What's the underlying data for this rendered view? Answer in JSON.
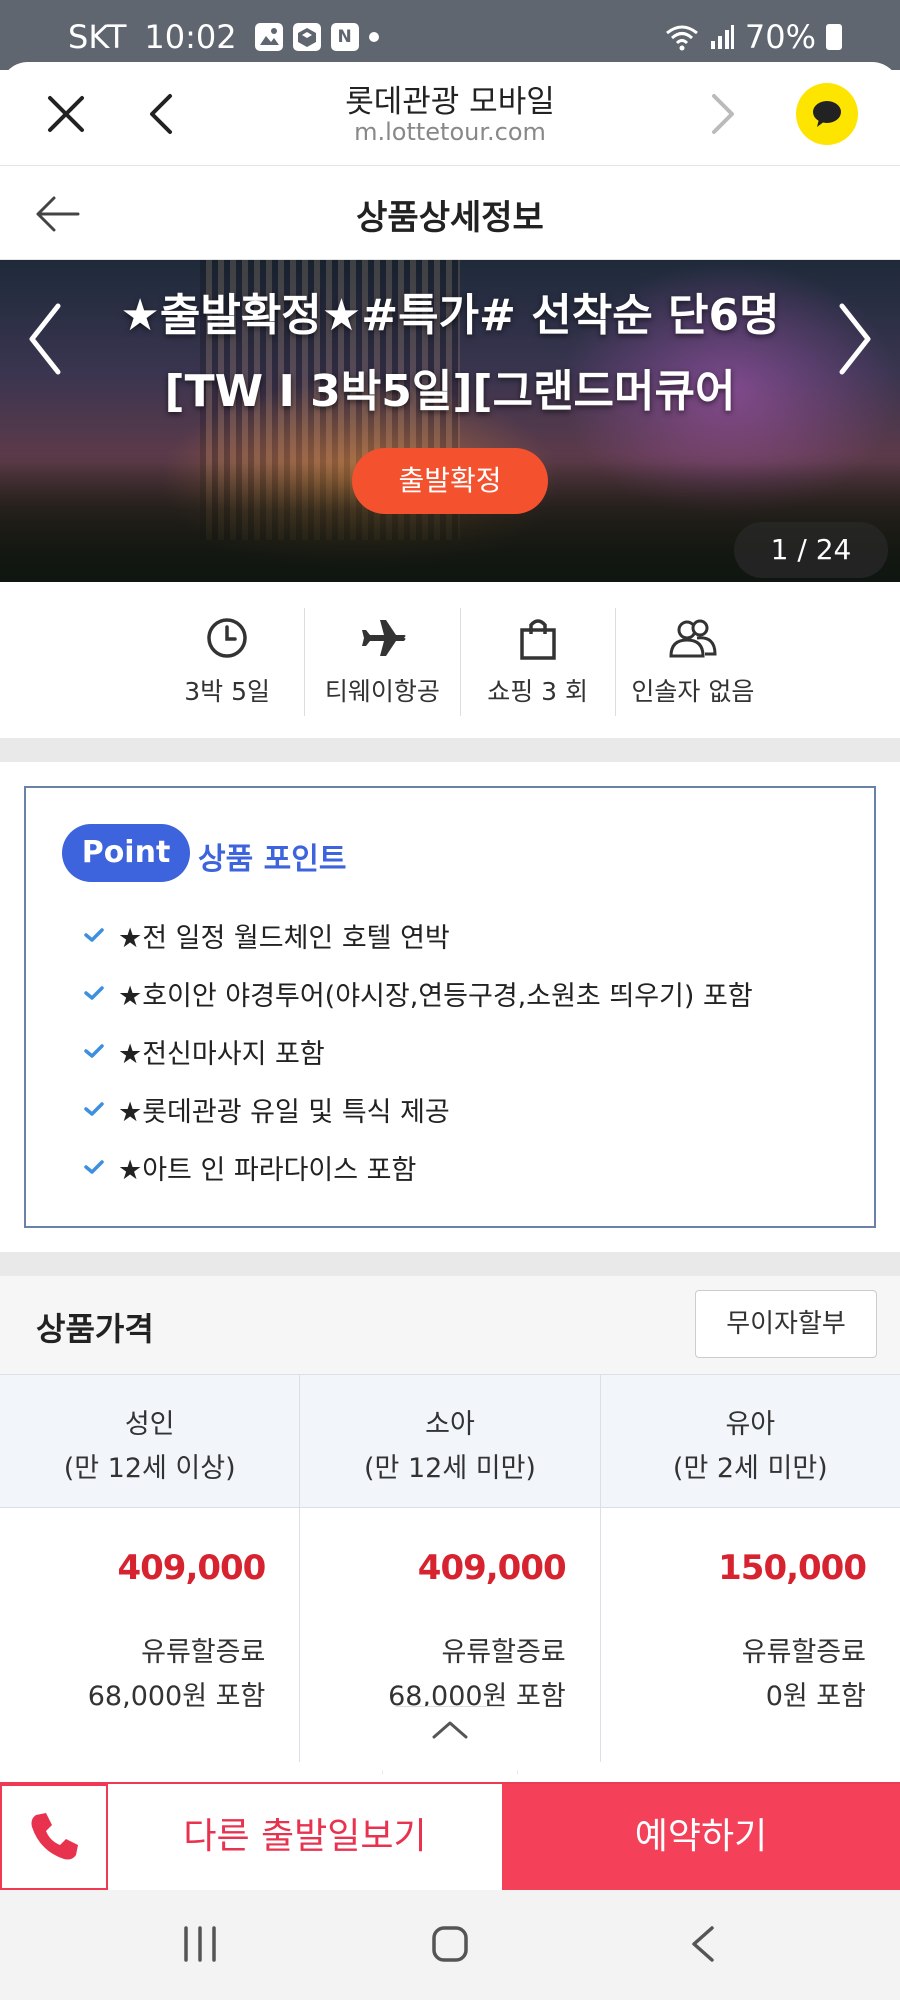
{
  "status_bar": {
    "carrier": "SKT",
    "time": "10:02",
    "battery": "70%",
    "notification_icons": [
      "image-icon",
      "box-icon",
      "naver-icon"
    ],
    "naver_letter": "N"
  },
  "browser": {
    "title": "롯데관광 모바일",
    "url": "m.lottetour.com"
  },
  "page": {
    "title": "상품상세정보"
  },
  "hero": {
    "title": "★출발확정★#특가# 선착순 단6명 [TW I 3박5일][그랜드머큐어",
    "badge": "출발확정",
    "counter": "1 / 24"
  },
  "info": [
    {
      "icon": "clock-icon",
      "label": "3박 5일"
    },
    {
      "icon": "airplane-icon",
      "label": "티웨이항공"
    },
    {
      "icon": "shopping-bag-icon",
      "label": "쇼핑 3 회"
    },
    {
      "icon": "people-icon",
      "label": "인솔자 없음"
    }
  ],
  "point": {
    "pill": "Point",
    "title": "상품 포인트",
    "items": [
      "★전 일정 월드체인 호텔 연박",
      "★호이안 야경투어(야시장,연등구경,소원초 띄우기) 포함",
      "★전신마사지 포함",
      "★롯데관광 유일 및 특식 제공",
      "★아트 인 파라다이스 포함"
    ]
  },
  "price": {
    "title": "상품가격",
    "installment_button": "무이자할부",
    "columns": [
      {
        "name": "성인",
        "age": "(만 12세 이상)",
        "price": "409,000",
        "note1": "유류할증료",
        "note2": "68,000원 포함"
      },
      {
        "name": "소아",
        "age": "(만 12세 미만)",
        "price": "409,000",
        "note1": "유류할증료",
        "note2": "68,000원 포함"
      },
      {
        "name": "유아",
        "age": "(만 2세 미만)",
        "price": "150,000",
        "note1": "유류할증료",
        "note2": "0원 포함"
      }
    ]
  },
  "actions": {
    "other_dates": "다른 출발일보기",
    "reserve": "예약하기"
  },
  "colors": {
    "accent_red": "#f5405a",
    "price_red": "#d6232f",
    "point_blue": "#3d63dd",
    "badge_orange": "#f4522f",
    "kakao_yellow": "#fee500"
  }
}
